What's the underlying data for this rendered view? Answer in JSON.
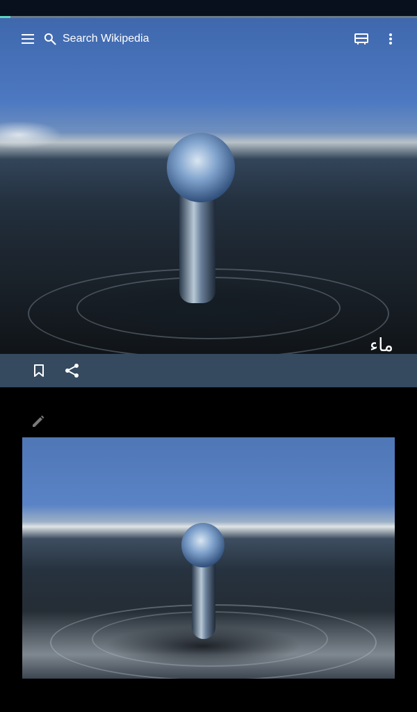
{
  "status_bar": {
    "progress_fraction": 0.025
  },
  "toolbar": {
    "menu_icon": "hamburger-menu-icon",
    "search_icon": "search-icon",
    "search_placeholder": "Search Wikipedia",
    "tabs_icon": "tabs-icon",
    "more_icon": "more-vertical-icon"
  },
  "lead": {
    "title": "ماء",
    "image_subject": "water drop splash"
  },
  "actions": {
    "bookmark_icon": "bookmark-icon",
    "share_icon": "share-icon"
  },
  "content": {
    "edit_icon": "pencil-edit-icon",
    "image_subject": "water drop splash"
  },
  "colors": {
    "action_bar_bg": "#354a5f",
    "progress_accent": "#5fd3c0",
    "page_bg": "#000000"
  }
}
